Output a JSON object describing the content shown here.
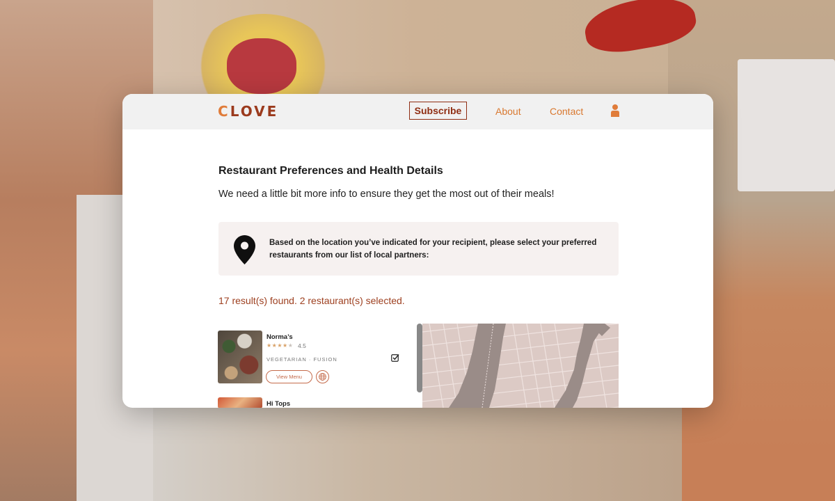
{
  "header": {
    "logo_first": "C",
    "logo_rest": "LOVE",
    "subscribe": "Subscribe",
    "about": "About",
    "contact": "Contact"
  },
  "main": {
    "heading": "Restaurant Preferences and Health Details",
    "subheading": "We need a little bit more info to ensure they get the most out of their meals!",
    "info_text": "Based on the location you’ve indicated for your recipient, please select your preferred restaurants from our list of local partners:",
    "results_text": "17 result(s) found. 2 restaurant(s) selected."
  },
  "restaurants": [
    {
      "name": "Norma’s",
      "stars_filled": "★★★★",
      "stars_empty": "★",
      "rating": "4.5",
      "categories": "VEGETARIAN · FUSION",
      "menu_label": "View Menu",
      "selected": true
    },
    {
      "name": "Hi Tops"
    }
  ],
  "icons": {
    "user": "user-icon",
    "pin": "location-pin-icon",
    "globe": "globe-icon",
    "check": "checkbox-checked-icon"
  },
  "colors": {
    "brand_dark": "#9b3a1d",
    "brand_accent": "#e07c3a",
    "link": "#d9782f",
    "results": "#9d3f1f"
  }
}
